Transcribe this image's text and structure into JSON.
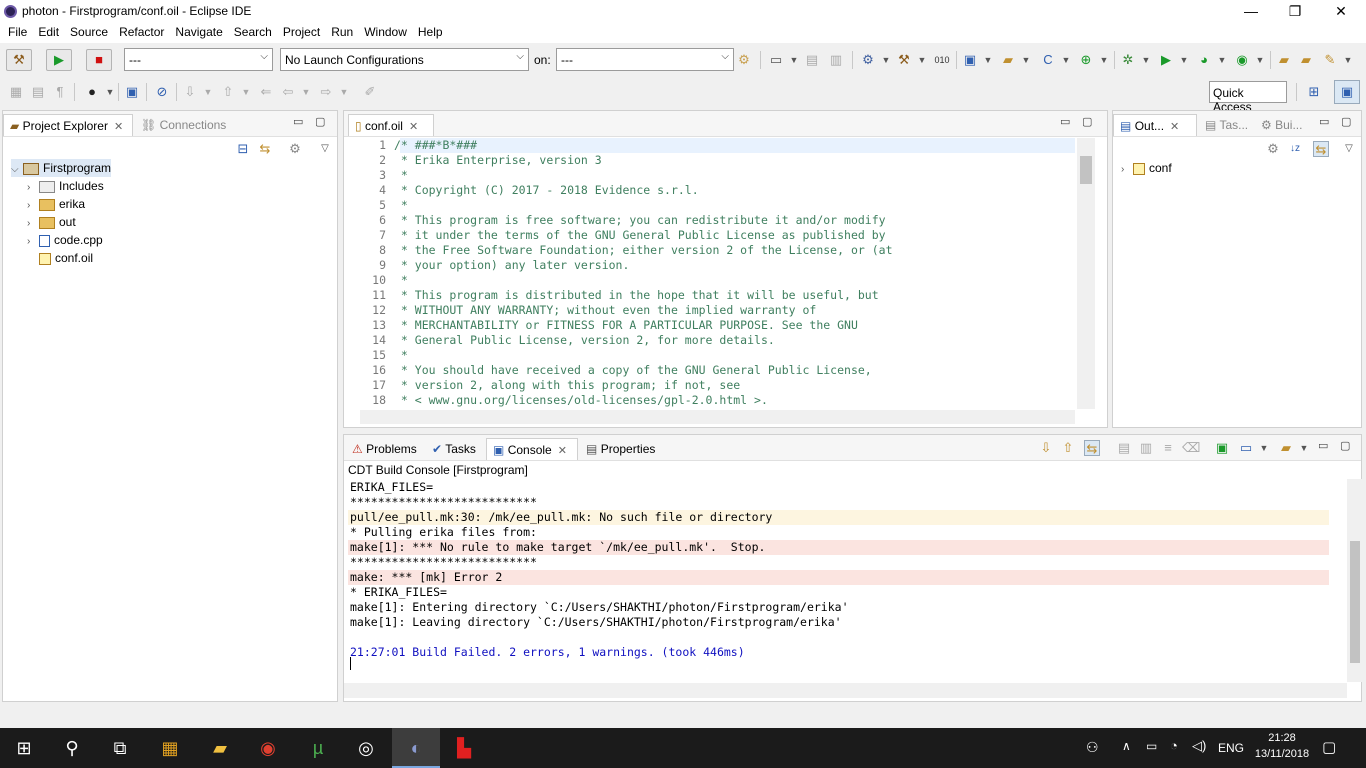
{
  "window": {
    "title": "photon - Firstprogram/conf.oil - Eclipse IDE",
    "minimize": "—",
    "restore": "❐",
    "close": "✕"
  },
  "menu": [
    "File",
    "Edit",
    "Source",
    "Refactor",
    "Navigate",
    "Search",
    "Project",
    "Run",
    "Window",
    "Help"
  ],
  "toolbar": {
    "launch_mode": "---",
    "launch_config": "No Launch Configurations",
    "on_label": "on:",
    "launch_target": "---",
    "quick_access": "Quick Access"
  },
  "project_explorer": {
    "tab_label": "Project Explorer",
    "connections_label": "Connections",
    "tree": [
      {
        "label": "Firstprogram",
        "kind": "project"
      },
      {
        "label": "Includes",
        "kind": "includes"
      },
      {
        "label": "erika",
        "kind": "folder"
      },
      {
        "label": "out",
        "kind": "folder"
      },
      {
        "label": "code.cpp",
        "kind": "file"
      },
      {
        "label": "conf.oil",
        "kind": "oil"
      }
    ]
  },
  "editor": {
    "tab_label": "conf.oil",
    "lines": [
      {
        "n": "1",
        "t": "/* ###*B*###"
      },
      {
        "n": "2",
        "t": " * Erika Enterprise, version 3"
      },
      {
        "n": "3",
        "t": " *"
      },
      {
        "n": "4",
        "t": " * Copyright (C) 2017 - 2018 Evidence s.r.l."
      },
      {
        "n": "5",
        "t": " *"
      },
      {
        "n": "6",
        "t": " * This program is free software; you can redistribute it and/or modify"
      },
      {
        "n": "7",
        "t": " * it under the terms of the GNU General Public License as published by"
      },
      {
        "n": "8",
        "t": " * the Free Software Foundation; either version 2 of the License, or (at"
      },
      {
        "n": "9",
        "t": " * your option) any later version."
      },
      {
        "n": "10",
        "t": " *"
      },
      {
        "n": "11",
        "t": " * This program is distributed in the hope that it will be useful, but"
      },
      {
        "n": "12",
        "t": " * WITHOUT ANY WARRANTY; without even the implied warranty of"
      },
      {
        "n": "13",
        "t": " * MERCHANTABILITY or FITNESS FOR A PARTICULAR PURPOSE. See the GNU"
      },
      {
        "n": "14",
        "t": " * General Public License, version 2, for more details."
      },
      {
        "n": "15",
        "t": " *"
      },
      {
        "n": "16",
        "t": " * You should have received a copy of the GNU General Public License,"
      },
      {
        "n": "17",
        "t": " * version 2, along with this program; if not, see"
      },
      {
        "n": "18",
        "t": " * < www.gnu.org/licenses/old-licenses/gpl-2.0.html >."
      }
    ]
  },
  "outline": {
    "tabs": [
      "Out...",
      "Tas...",
      "Bui..."
    ],
    "tree": [
      {
        "label": "conf"
      }
    ]
  },
  "console": {
    "tabs": [
      "Problems",
      "Tasks",
      "Console",
      "Properties"
    ],
    "header": "CDT Build Console [Firstprogram]",
    "lines": [
      {
        "t": "ERIKA_FILES=",
        "s": "normal"
      },
      {
        "t": "***************************",
        "s": "normal"
      },
      {
        "t": "pull/ee_pull.mk:30: /mk/ee_pull.mk: No such file or directory",
        "s": "warn"
      },
      {
        "t": "* Pulling erika files from:",
        "s": "normal"
      },
      {
        "t": "make[1]: *** No rule to make target `/mk/ee_pull.mk'.  Stop.",
        "s": "err"
      },
      {
        "t": "***************************",
        "s": "normal"
      },
      {
        "t": "make: *** [mk] Error 2",
        "s": "err"
      },
      {
        "t": "* ERIKA_FILES=",
        "s": "normal"
      },
      {
        "t": "make[1]: Entering directory `C:/Users/SHAKTHI/photon/Firstprogram/erika'",
        "s": "normal"
      },
      {
        "t": "make[1]: Leaving directory `C:/Users/SHAKTHI/photon/Firstprogram/erika'",
        "s": "normal"
      },
      {
        "t": "",
        "s": "normal"
      },
      {
        "t": "21:27:01 Build Failed. 2 errors, 1 warnings. (took 446ms)",
        "s": "blue"
      }
    ]
  },
  "taskbar": {
    "time": "21:28",
    "date": "13/11/2018",
    "lang": "ENG"
  },
  "colors": {
    "error_bg": "#fbe4e0",
    "warn_bg": "#fdf5e0",
    "comment": "#3f7f5f",
    "console_blue": "#1010c0"
  }
}
